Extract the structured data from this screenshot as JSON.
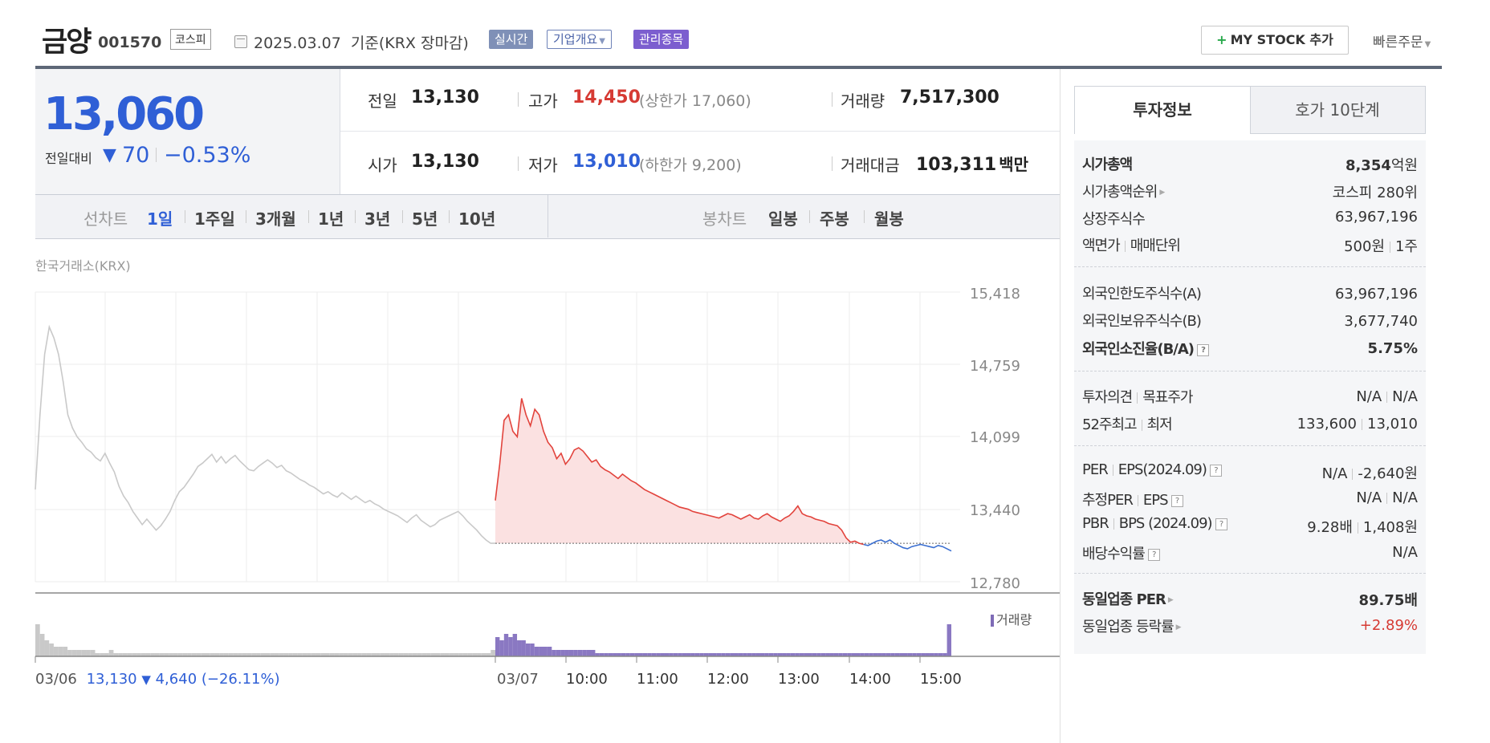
{
  "header": {
    "name": "금양",
    "code": "001570",
    "market": "코스피",
    "date": "2025.03.07",
    "basis": "기준(KRX 장마감)",
    "badges": {
      "realtime": "실시간",
      "corp": "기업개요",
      "admin": "관리종목"
    },
    "mystock": "MY STOCK 추가",
    "quick_order": "빠른주문"
  },
  "quote": {
    "price": "13,060",
    "change_label": "전일대비",
    "change_value": "70",
    "change_pct": "−0.53%",
    "prev_close_label": "전일",
    "prev_close": "13,130",
    "high_label": "고가",
    "high": "14,450",
    "upper_limit_label": "(상한가",
    "upper_limit": "17,060)",
    "volume_label": "거래량",
    "volume": "7,517,300",
    "open_label": "시가",
    "open": "13,130",
    "low_label": "저가",
    "low": "13,010",
    "lower_limit_label": "(하한가",
    "lower_limit": "9,200)",
    "amount_label": "거래대금",
    "amount": "103,311",
    "amount_unit": "백만"
  },
  "periods": {
    "line_title": "선차트",
    "line_items": [
      "1일",
      "1주일",
      "3개월",
      "1년",
      "3년",
      "5년",
      "10년"
    ],
    "candle_title": "봉차트",
    "candle_items": [
      "일봉",
      "주봉",
      "월봉"
    ]
  },
  "source": "한국거래소(KRX)",
  "volume_legend": "거래량",
  "prev_day_info": {
    "date": "03/06",
    "close": "13,130",
    "arrow": "▼",
    "change": "4,640",
    "pct": "(−26.11%)"
  },
  "colors": {
    "up": "#d63a33",
    "down": "#2f5fd6",
    "prev_line": "#c9c9c9",
    "volume": "#7e6bb6"
  },
  "chart_data": {
    "type": "line",
    "y_ticks": [
      "15,418",
      "14,759",
      "14,099",
      "13,440",
      "12,780"
    ],
    "ylim": [
      12780,
      15418
    ],
    "x_ticks": [
      "03/06",
      "03/07",
      "10:00",
      "11:00",
      "12:00",
      "13:00",
      "14:00",
      "15:00"
    ],
    "baseline": 13130,
    "prev_day_series": {
      "values": [
        13620,
        14300,
        14850,
        15100,
        15000,
        14850,
        14600,
        14300,
        14180,
        14100,
        14050,
        13990,
        13960,
        13910,
        13880,
        13950,
        13860,
        13780,
        13650,
        13560,
        13500,
        13420,
        13360,
        13300,
        13350,
        13300,
        13250,
        13290,
        13350,
        13420,
        13520,
        13600,
        13640,
        13700,
        13760,
        13830,
        13860,
        13900,
        13940,
        13870,
        13920,
        13860,
        13900,
        13930,
        13880,
        13840,
        13800,
        13790,
        13830,
        13860,
        13890,
        13860,
        13820,
        13840,
        13790,
        13770,
        13740,
        13710,
        13690,
        13660,
        13640,
        13610,
        13580,
        13600,
        13570,
        13550,
        13590,
        13560,
        13530,
        13560,
        13530,
        13500,
        13520,
        13490,
        13470,
        13440,
        13420,
        13400,
        13380,
        13350,
        13320,
        13360,
        13390,
        13340,
        13310,
        13280,
        13300,
        13340,
        13360,
        13380,
        13400,
        13420,
        13380,
        13330,
        13290,
        13250,
        13200,
        13160,
        13130,
        13130
      ]
    },
    "today_series": {
      "values": [
        13520,
        13850,
        14250,
        14300,
        14150,
        14100,
        14450,
        14300,
        14200,
        14350,
        14300,
        14150,
        14050,
        14000,
        13900,
        13950,
        13850,
        13900,
        13980,
        14000,
        13970,
        13920,
        13870,
        13890,
        13830,
        13800,
        13780,
        13750,
        13720,
        13760,
        13730,
        13700,
        13680,
        13650,
        13620,
        13600,
        13580,
        13560,
        13540,
        13520,
        13500,
        13480,
        13460,
        13450,
        13440,
        13420,
        13410,
        13400,
        13390,
        13380,
        13370,
        13360,
        13380,
        13400,
        13390,
        13370,
        13350,
        13370,
        13390,
        13360,
        13350,
        13380,
        13400,
        13370,
        13350,
        13330,
        13360,
        13380,
        13420,
        13470,
        13400,
        13380,
        13370,
        13350,
        13340,
        13330,
        13310,
        13300,
        13290,
        13250,
        13180,
        13140,
        13150,
        13130,
        13120,
        13110,
        13130,
        13150,
        13160,
        13140,
        13160,
        13130,
        13110,
        13090,
        13080,
        13100,
        13110,
        13120,
        13110,
        13100,
        13090,
        13110,
        13100,
        13080,
        13060
      ]
    },
    "volume": {
      "prev_day": [
        10,
        7,
        5,
        4,
        3,
        3,
        3,
        2,
        2,
        2,
        2,
        2,
        2,
        1,
        1,
        1,
        2,
        1,
        1,
        1,
        1,
        1,
        1,
        1,
        1,
        1,
        1,
        1,
        1,
        1,
        1,
        1,
        1,
        1,
        1,
        1,
        1,
        1,
        1,
        1,
        1,
        1,
        1,
        1,
        1,
        1,
        1,
        1,
        1,
        1,
        1,
        1,
        1,
        1,
        1,
        1,
        1,
        1,
        1,
        1,
        1,
        1,
        1,
        1,
        1,
        1,
        1,
        1,
        1,
        1,
        1,
        1,
        1,
        1,
        1,
        1,
        1,
        1,
        1,
        1,
        1,
        1,
        1,
        1,
        1,
        1,
        1,
        1,
        1,
        1,
        1,
        1,
        1,
        1,
        1,
        1,
        1,
        1,
        1,
        2
      ],
      "today": [
        6,
        5,
        7,
        6,
        7,
        5,
        5,
        4,
        4,
        3,
        3,
        3,
        3,
        2,
        2,
        2,
        2,
        2,
        2,
        2,
        2,
        2,
        2,
        1,
        1,
        1,
        1,
        1,
        1,
        1,
        1,
        1,
        1,
        1,
        1,
        1,
        1,
        1,
        1,
        1,
        1,
        1,
        1,
        1,
        1,
        1,
        1,
        1,
        1,
        1,
        1,
        1,
        1,
        1,
        1,
        1,
        1,
        1,
        1,
        1,
        1,
        1,
        1,
        1,
        1,
        1,
        1,
        1,
        1,
        1,
        1,
        1,
        1,
        1,
        1,
        1,
        1,
        1,
        1,
        1,
        1,
        1,
        1,
        1,
        1,
        1,
        1,
        1,
        1,
        1,
        1,
        1,
        1,
        1,
        1,
        1,
        1,
        1,
        1,
        1,
        1,
        1,
        1,
        1,
        10
      ]
    }
  },
  "panel": {
    "tab_active": "투자정보",
    "tab_other": "호가 10단계",
    "rows": {
      "mcap_label": "시가총액",
      "mcap_value": "8,354",
      "mcap_unit": "억원",
      "rank_label": "시가총액순위",
      "rank_value": "코스피 280위",
      "shares_label": "상장주식수",
      "shares_value": "63,967,196",
      "par_label": "액면가",
      "lot_label": "매매단위",
      "par_value": "500원",
      "lot_value": "1주",
      "foreign_limit_label": "외국인한도주식수(A)",
      "foreign_limit_value": "63,967,196",
      "foreign_hold_label": "외국인보유주식수(B)",
      "foreign_hold_value": "3,677,740",
      "foreign_ratio_label": "외국인소진율(B/A)",
      "foreign_ratio_value": "5.75%",
      "opinion_label": "투자의견",
      "target_label": "목표주가",
      "opinion_value": "N/A",
      "target_value": "N/A",
      "w52_high_label": "52주최고",
      "w52_low_label": "최저",
      "w52_high_value": "133,600",
      "w52_low_value": "13,010",
      "per_label": "PER",
      "eps_label": "EPS(2024.09)",
      "per_value": "N/A",
      "eps_value": "-2,640원",
      "est_per_label": "추정PER",
      "est_eps_label": "EPS",
      "est_per_value": "N/A",
      "est_eps_value": "N/A",
      "pbr_label": "PBR",
      "bps_label": "BPS (2024.09)",
      "pbr_value": "9.28배",
      "bps_value": "1,408원",
      "div_label": "배당수익률",
      "div_value": "N/A",
      "ind_per_label": "동일업종 PER",
      "ind_per_value": "89.75배",
      "ind_change_label": "동일업종 등락률",
      "ind_change_value": "+2.89%"
    }
  }
}
